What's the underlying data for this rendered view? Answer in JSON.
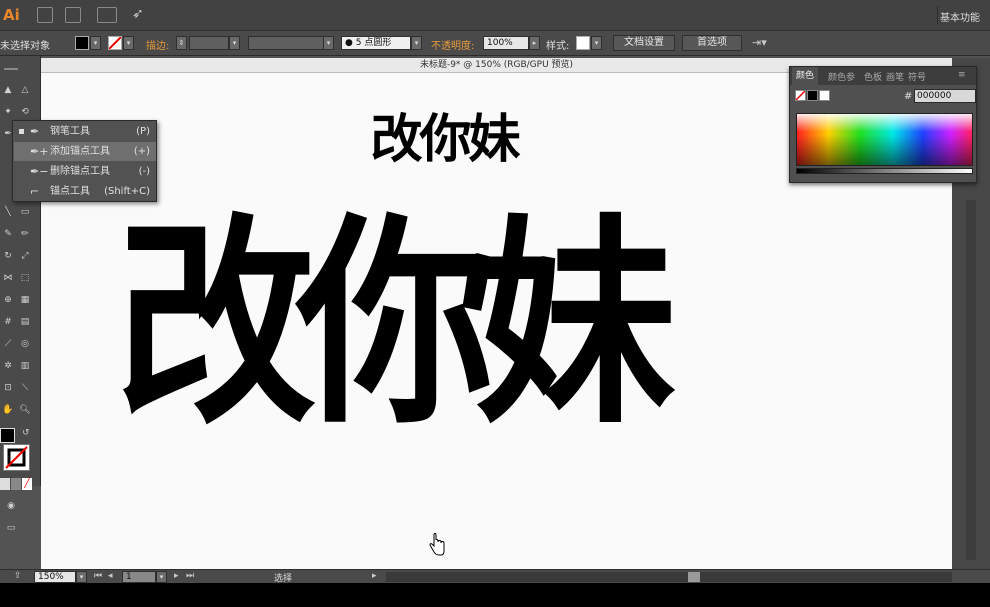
{
  "app": {
    "logo_text": "Ai",
    "workspace_label": "基本功能"
  },
  "control_bar": {
    "selection_label": "未选择对象",
    "stroke_label": "描边:",
    "brush_label": "5 点圆形",
    "opacity_label": "不透明度:",
    "opacity_value": "100%",
    "style_label": "样式:",
    "doc_setup_button": "文档设置",
    "preferences_button": "首选项"
  },
  "document": {
    "tab_title": "未标题-9* @ 150% (RGB/GPU 预览)",
    "headline_small": "改你妹",
    "headline_big": "改你妹"
  },
  "pen_flyout": {
    "items": [
      {
        "label": "钢笔工具",
        "shortcut": "(P)",
        "icon": "pen-icon"
      },
      {
        "label": "添加锚点工具",
        "shortcut": "(+)",
        "icon": "add-anchor-icon"
      },
      {
        "label": "删除锚点工具",
        "shortcut": "(-)",
        "icon": "delete-anchor-icon"
      },
      {
        "label": "锚点工具",
        "shortcut": "(Shift+C)",
        "icon": "anchor-point-icon"
      }
    ]
  },
  "color_panel": {
    "tabs": [
      "颜色",
      "颜色参",
      "色板",
      "画笔",
      "符号"
    ],
    "hex_prefix": "#",
    "hex_value": "000000"
  },
  "status_bar": {
    "zoom": "150%",
    "artboard": "1",
    "tool_status": "选择"
  },
  "colors": {
    "accent_orange": "#e89a3c",
    "fill": "#000000",
    "panel_bg": "#505050"
  }
}
